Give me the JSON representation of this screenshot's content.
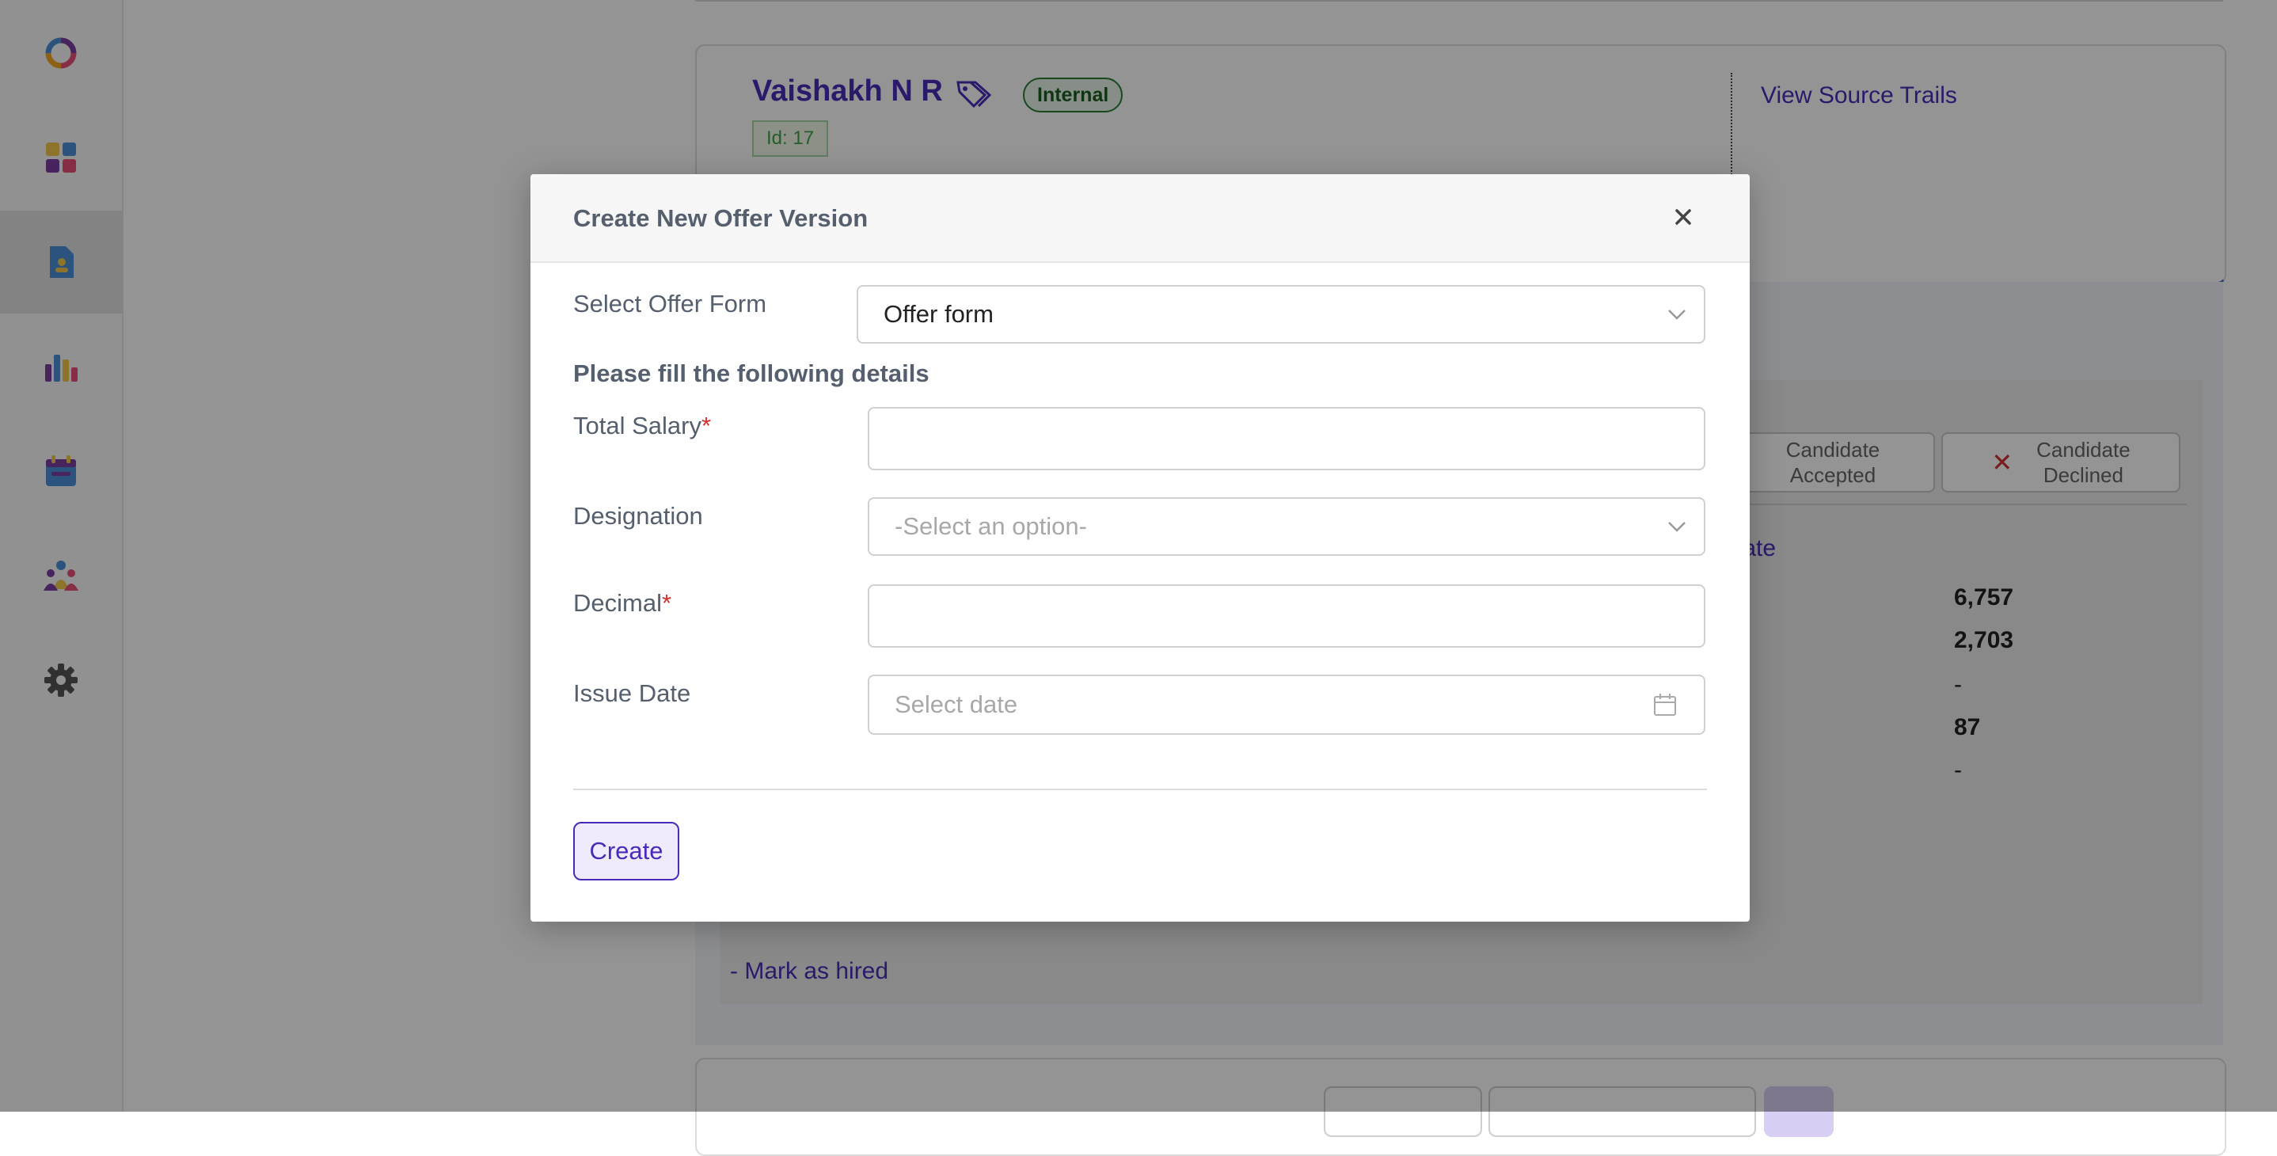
{
  "sidebar": {
    "items": [
      {
        "icon": "ring-logo-icon"
      },
      {
        "icon": "dashboard-grid-icon"
      },
      {
        "icon": "candidate-document-icon",
        "active": true
      },
      {
        "icon": "bar-chart-icon"
      },
      {
        "icon": "calendar-icon"
      },
      {
        "icon": "team-icon"
      },
      {
        "icon": "gear-icon"
      }
    ]
  },
  "candidate": {
    "name": "Vaishakh N R",
    "badge": "Internal",
    "id_label": "Id: 17",
    "source_link": "View Source Trails"
  },
  "status": {
    "accepted_line1": "Candidate",
    "accepted_line2": "Accepted",
    "declined_line1": "Candidate",
    "declined_line2": "Declined"
  },
  "details": {
    "update_link": "odate",
    "values": [
      "6,757",
      "2,703",
      "-",
      "87",
      "-"
    ],
    "mark_hired": "- Mark as hired"
  },
  "modal": {
    "title": "Create New Offer Version",
    "select_offer_form_label": "Select Offer Form",
    "select_offer_form_value": "Offer form",
    "section_heading": "Please fill the following details",
    "total_salary_label": "Total Salary",
    "designation_label": "Designation",
    "designation_placeholder": "-Select an option-",
    "decimal_label": "Decimal",
    "issue_date_label": "Issue Date",
    "issue_date_placeholder": "Select date",
    "required_marker": "*",
    "create_button": "Create"
  },
  "colors": {
    "accent": "#4a2bb8",
    "required": "#d32f2f",
    "internal_badge": "#2e7d32",
    "overlay": "rgba(0,0,0,0.42)"
  }
}
